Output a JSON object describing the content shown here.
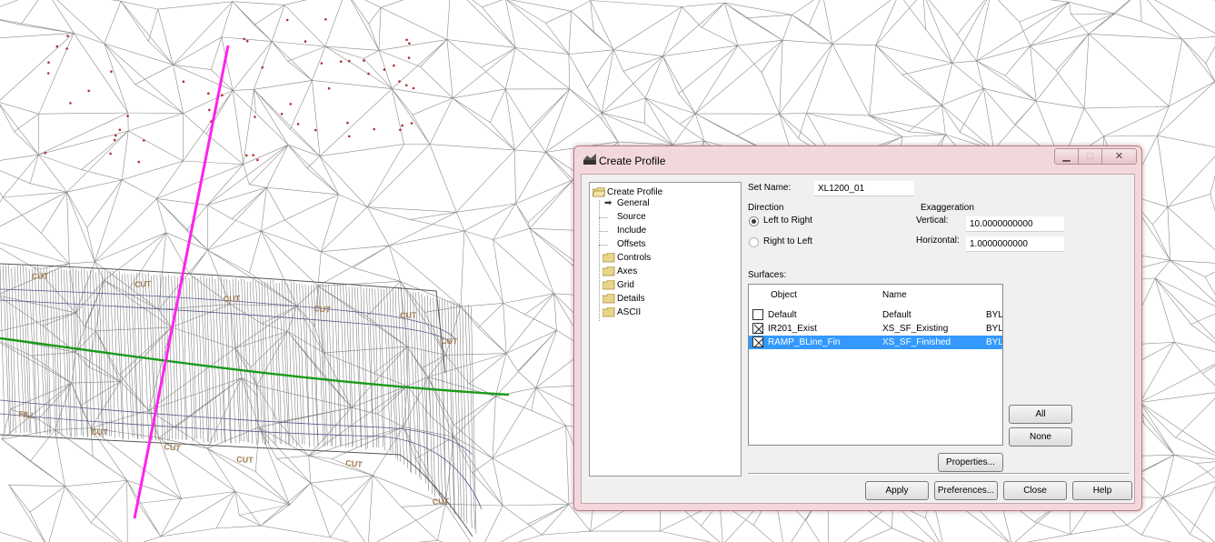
{
  "window": {
    "title": "Create Profile"
  },
  "tree": {
    "root": "Create Profile",
    "items": [
      {
        "label": "General",
        "current": true
      },
      {
        "label": "Source"
      },
      {
        "label": "Include"
      },
      {
        "label": "Offsets"
      },
      {
        "label": "Controls"
      },
      {
        "label": "Axes"
      },
      {
        "label": "Grid"
      },
      {
        "label": "Details"
      },
      {
        "label": "ASCII"
      }
    ]
  },
  "form": {
    "set_name_label": "Set Name:",
    "set_name_value": "XL1200_01",
    "direction_label": "Direction",
    "left_to_right": "Left to Right",
    "right_to_left": "Right to Left",
    "direction_selected": "Left to Right",
    "exaggeration_label": "Exaggeration",
    "vertical_label": "Vertical:",
    "vertical_value": "10.0000000000",
    "horizontal_label": "Horizontal:",
    "horizontal_value": "1.0000000000",
    "surfaces_label": "Surfaces:"
  },
  "surfaces": {
    "columns": [
      "Object",
      "Name"
    ],
    "rows": [
      {
        "object": "Default",
        "name": "Default",
        "extra": "BYL",
        "checked": false,
        "selected": false
      },
      {
        "object": "IR201_Exist",
        "name": "XS_SF_Existing",
        "extra": "BYL",
        "checked": true,
        "selected": false
      },
      {
        "object": "RAMP_BLine_Fin",
        "name": "XS_SF_Finished",
        "extra": "BYL",
        "checked": true,
        "selected": true
      }
    ]
  },
  "buttons": {
    "all": "All",
    "none": "None",
    "properties": "Properties...",
    "apply": "Apply",
    "preferences": "Preferences...",
    "close": "Close",
    "help": "Help"
  },
  "drawing": {
    "labels": [
      "CUT",
      "CUT",
      "CUT",
      "CUT",
      "CUT",
      "CUT",
      "FILL",
      "CUT",
      "CUT",
      "CUT",
      "CUT",
      "CUT"
    ]
  },
  "colors": {
    "alignment_magenta": "#ff22ee",
    "centerline_green": "#1a9a1a",
    "selection_blue": "#3399ff",
    "window_frame": "#f2d8dc"
  }
}
